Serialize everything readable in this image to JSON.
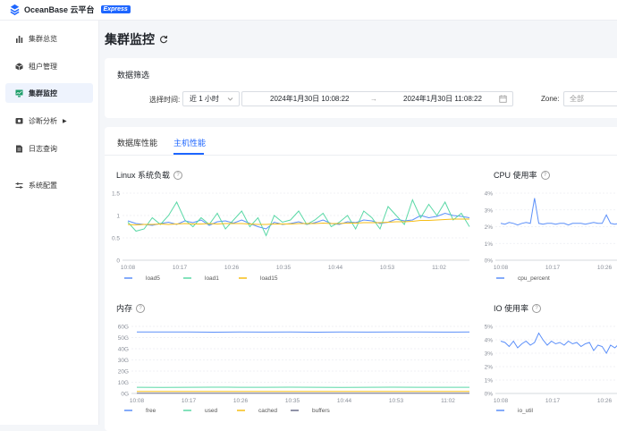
{
  "brand": {
    "name": "OceanBase 云平台",
    "badge": "Express"
  },
  "sidebar": {
    "items": [
      {
        "label": "集群总览",
        "icon": "bar-chart-icon",
        "active": false
      },
      {
        "label": "租户管理",
        "icon": "cube-icon",
        "active": false
      },
      {
        "label": "集群监控",
        "icon": "monitor-icon",
        "active": true
      },
      {
        "label": "诊断分析",
        "icon": "diagnose-icon",
        "active": false,
        "has_submenu": true
      },
      {
        "label": "日志查询",
        "icon": "log-icon",
        "active": false
      },
      {
        "label": "系统配置",
        "icon": "settings-sliders-icon",
        "active": false
      }
    ]
  },
  "page": {
    "title": "集群监控",
    "refresh_icon": "refresh-icon"
  },
  "filter": {
    "section_title": "数据筛选",
    "time_label": "选择时间:",
    "time_range_value": "近 1 小时",
    "start_time": "2024年1月30日 10:08:22",
    "end_time": "2024年1月30日 11:08:22",
    "range_separator": "→",
    "zone_label": "Zone:",
    "zone_placeholder": "全部"
  },
  "tabs": [
    {
      "label": "数据库性能",
      "active": false
    },
    {
      "label": "主机性能",
      "active": true
    }
  ],
  "chart_data": [
    {
      "type": "line",
      "title": "Linux 系统负载",
      "x": [
        "10:08",
        "10:17",
        "10:26",
        "10:35",
        "10:44",
        "10:53",
        "11:02"
      ],
      "yticks": [
        "0",
        "0.5",
        "1",
        "1.5"
      ],
      "ylim": [
        0,
        1.5
      ],
      "series": [
        {
          "name": "load5",
          "color": "#5b8ff9",
          "values": [
            0.88,
            0.82,
            0.8,
            0.78,
            0.82,
            0.85,
            0.8,
            0.88,
            0.84,
            0.9,
            0.78,
            0.86,
            0.88,
            0.83,
            0.9,
            0.82,
            0.75,
            0.7,
            0.85,
            0.8,
            0.82,
            0.86,
            0.8,
            0.84,
            0.9,
            0.82,
            0.8,
            0.86,
            0.84,
            0.9,
            0.88,
            0.82,
            0.85,
            0.92,
            0.88,
            0.9,
            1.0,
            0.95,
            0.98,
            1.05,
            1.0,
            0.98,
            0.95
          ]
        },
        {
          "name": "load1",
          "color": "#5ad8a6",
          "values": [
            0.85,
            0.65,
            0.7,
            0.95,
            0.8,
            1.0,
            1.3,
            0.9,
            0.75,
            0.95,
            0.8,
            1.05,
            0.7,
            0.9,
            1.1,
            0.75,
            0.95,
            0.55,
            1.0,
            0.85,
            0.9,
            1.1,
            0.8,
            0.9,
            1.05,
            0.75,
            0.85,
            1.0,
            0.7,
            1.1,
            0.95,
            0.7,
            1.2,
            1.0,
            0.8,
            1.35,
            0.95,
            1.25,
            1.0,
            1.3,
            0.9,
            1.05,
            0.75
          ]
        },
        {
          "name": "load15",
          "color": "#f6bd16",
          "values": [
            0.8,
            0.79,
            0.8,
            0.8,
            0.81,
            0.8,
            0.81,
            0.82,
            0.81,
            0.81,
            0.82,
            0.81,
            0.82,
            0.82,
            0.82,
            0.81,
            0.8,
            0.8,
            0.81,
            0.81,
            0.81,
            0.82,
            0.82,
            0.82,
            0.83,
            0.82,
            0.82,
            0.83,
            0.83,
            0.84,
            0.84,
            0.84,
            0.85,
            0.86,
            0.86,
            0.87,
            0.89,
            0.89,
            0.9,
            0.91,
            0.92,
            0.92,
            0.92
          ]
        }
      ],
      "legend": "bottom"
    },
    {
      "type": "line",
      "title": "CPU 使用率",
      "x": [
        "10:08",
        "10:17",
        "10:26"
      ],
      "yticks": [
        "0%",
        "1%",
        "2%",
        "3%",
        "4%"
      ],
      "ylim": [
        0,
        4
      ],
      "series": [
        {
          "name": "cpu_percent",
          "color": "#5b8ff9",
          "values": [
            2.2,
            2.15,
            2.25,
            2.2,
            2.1,
            2.2,
            2.25,
            2.2,
            3.7,
            2.2,
            2.15,
            2.2,
            2.2,
            2.15,
            2.2,
            2.2,
            2.1,
            2.2,
            2.2,
            2.2,
            2.15,
            2.2,
            2.25,
            2.2,
            2.2,
            2.7,
            2.2,
            2.15,
            2.2,
            2.2
          ]
        }
      ],
      "legend": "bottom"
    },
    {
      "type": "line",
      "title": "内存",
      "x": [
        "10:08",
        "10:17",
        "10:26",
        "10:35",
        "10:44",
        "10:53",
        "11:02"
      ],
      "yticks": [
        "0G",
        "10G",
        "20G",
        "30G",
        "40G",
        "50G",
        "60G"
      ],
      "ylim": [
        0,
        60
      ],
      "series": [
        {
          "name": "free",
          "color": "#5b8ff9",
          "values": [
            55,
            55,
            55,
            54.8,
            55,
            54.9,
            55,
            54.8,
            55,
            54.9,
            55,
            55,
            54.9,
            55
          ]
        },
        {
          "name": "used",
          "color": "#5ad8a6",
          "values": [
            5.5,
            5.4,
            5.5,
            5.6,
            5.5,
            5.5,
            5.6,
            5.5,
            5.4,
            5.5,
            5.6,
            5.5,
            5.5,
            5.5
          ]
        },
        {
          "name": "cached",
          "color": "#f6bd16",
          "values": [
            1.8,
            1.8,
            1.8,
            1.8,
            1.8,
            1.8,
            1.8,
            1.8,
            1.8,
            1.8,
            1.8,
            1.8,
            1.8,
            1.8
          ]
        },
        {
          "name": "buffers",
          "color": "#6a6f8a",
          "values": [
            0.2,
            0.2,
            0.2,
            0.2,
            0.2,
            0.2,
            0.2,
            0.2,
            0.2,
            0.2,
            0.2,
            0.2,
            0.2,
            0.2
          ]
        }
      ],
      "legend": "bottom"
    },
    {
      "type": "line",
      "title": "IO 使用率",
      "x": [
        "10:08",
        "10:17",
        "10:26"
      ],
      "yticks": [
        "0%",
        "1%",
        "2%",
        "3%",
        "4%",
        "5%"
      ],
      "ylim": [
        0,
        5
      ],
      "series": [
        {
          "name": "io_util",
          "color": "#5b8ff9",
          "values": [
            3.9,
            3.8,
            3.5,
            3.9,
            3.4,
            3.7,
            3.9,
            3.6,
            3.8,
            4.5,
            4.0,
            3.6,
            3.9,
            3.7,
            3.8,
            3.6,
            3.9,
            3.7,
            3.8,
            3.5,
            3.7,
            3.8,
            3.2,
            3.6,
            3.5,
            3.0,
            3.6,
            3.4,
            3.7,
            3.5
          ]
        }
      ],
      "legend": "bottom"
    }
  ]
}
